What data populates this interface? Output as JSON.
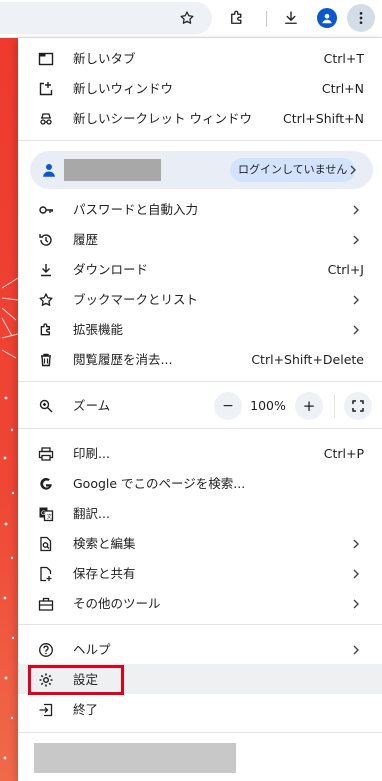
{
  "menu": {
    "new_tab": {
      "label": "新しいタブ",
      "shortcut": "Ctrl+T"
    },
    "new_window": {
      "label": "新しいウィンドウ",
      "shortcut": "Ctrl+N"
    },
    "new_incognito": {
      "label": "新しいシークレット ウィンドウ",
      "shortcut": "Ctrl+Shift+N"
    },
    "profile": {
      "status": "ログインしていません"
    },
    "passwords": {
      "label": "パスワードと自動入力"
    },
    "history": {
      "label": "履歴"
    },
    "downloads": {
      "label": "ダウンロード",
      "shortcut": "Ctrl+J"
    },
    "bookmarks": {
      "label": "ブックマークとリスト"
    },
    "extensions": {
      "label": "拡張機能"
    },
    "clear_data": {
      "label": "閲覧履歴を消去...",
      "shortcut": "Ctrl+Shift+Delete"
    },
    "zoom": {
      "label": "ズーム",
      "value": "100%",
      "minus": "−",
      "plus": "+"
    },
    "print": {
      "label": "印刷...",
      "shortcut": "Ctrl+P"
    },
    "google_search": {
      "label": "Google でこのページを検索..."
    },
    "translate": {
      "label": "翻訳..."
    },
    "search_edit": {
      "label": "検索と編集"
    },
    "save_share": {
      "label": "保存と共有"
    },
    "more_tools": {
      "label": "その他のツール"
    },
    "help": {
      "label": "ヘルプ"
    },
    "settings": {
      "label": "設定"
    },
    "exit": {
      "label": "終了"
    }
  },
  "colors": {
    "accent_blue": "#0b57d0",
    "highlight_red": "#e2001a",
    "page_red": "#ee3a2f"
  }
}
